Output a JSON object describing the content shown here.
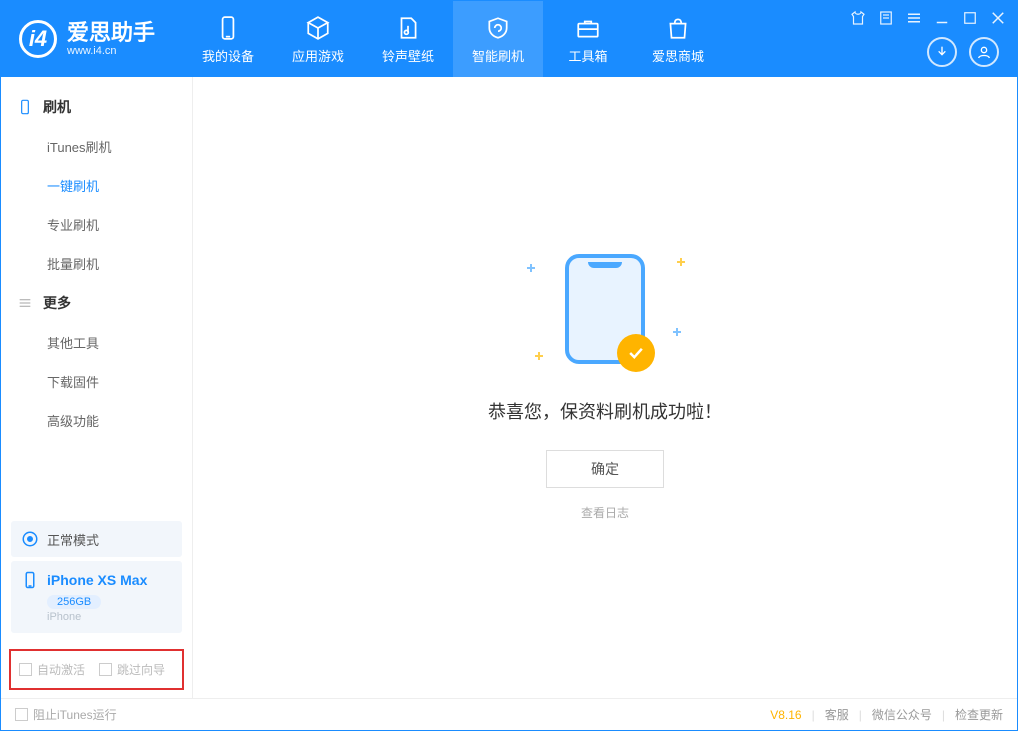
{
  "brand": {
    "name": "爱思助手",
    "url": "www.i4.cn"
  },
  "nav": {
    "items": [
      {
        "label": "我的设备"
      },
      {
        "label": "应用游戏"
      },
      {
        "label": "铃声壁纸"
      },
      {
        "label": "智能刷机"
      },
      {
        "label": "工具箱"
      },
      {
        "label": "爱思商城"
      }
    ]
  },
  "sidebar": {
    "group1": {
      "title": "刷机",
      "items": [
        "iTunes刷机",
        "一键刷机",
        "专业刷机",
        "批量刷机"
      ]
    },
    "group2": {
      "title": "更多",
      "items": [
        "其他工具",
        "下载固件",
        "高级功能"
      ]
    }
  },
  "mode": {
    "label": "正常模式"
  },
  "device": {
    "name": "iPhone XS Max",
    "capacity": "256GB",
    "type": "iPhone"
  },
  "options": {
    "auto_activate": "自动激活",
    "skip_guide": "跳过向导"
  },
  "main": {
    "success": "恭喜您，保资料刷机成功啦！",
    "ok": "确定",
    "view_log": "查看日志"
  },
  "status": {
    "block_itunes": "阻止iTunes运行",
    "version": "V8.16",
    "links": [
      "客服",
      "微信公众号",
      "检查更新"
    ]
  }
}
